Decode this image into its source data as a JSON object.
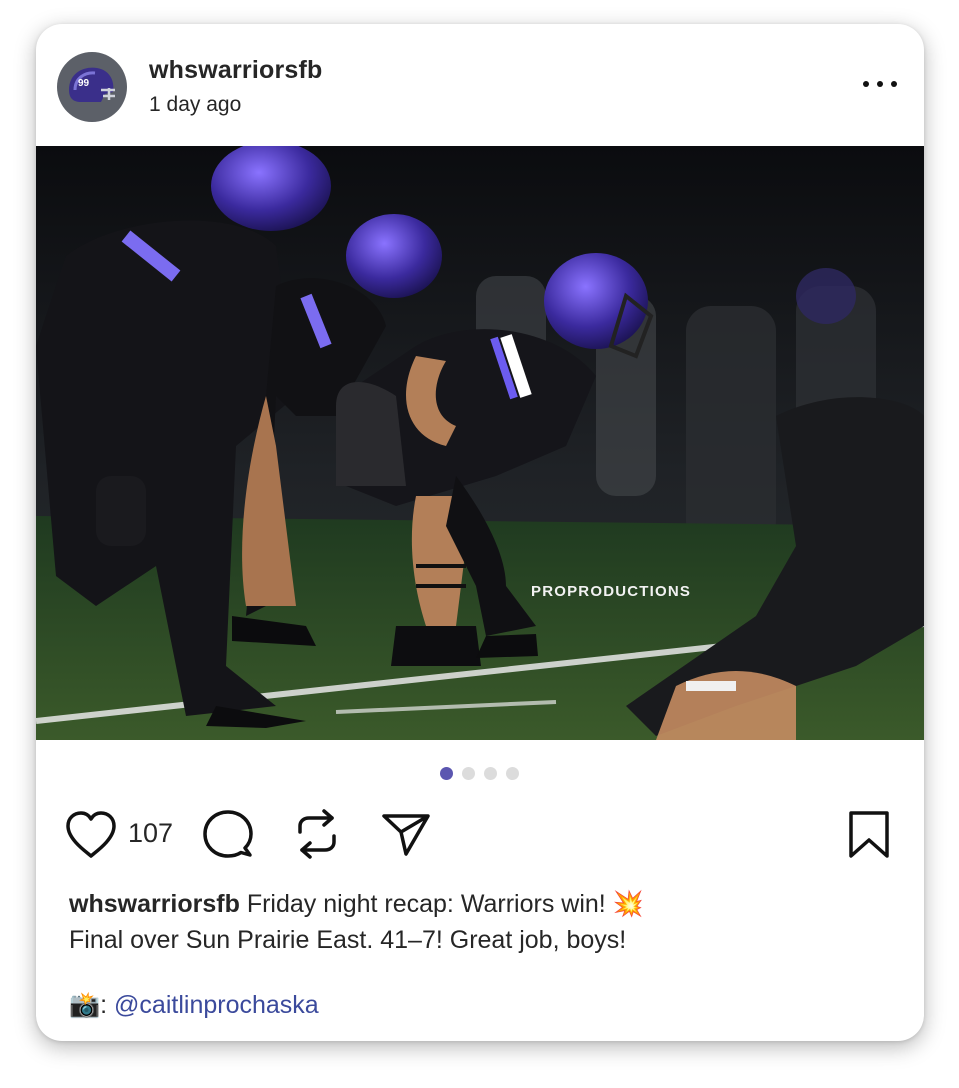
{
  "post": {
    "username": "whswarriorsfb",
    "timestamp": "1 day ago",
    "avatar_text": "99",
    "photo_watermark": "PROPRODUCTIONS",
    "carousel": {
      "count": 4,
      "active_index": 1
    },
    "likes": "107",
    "caption": {
      "username": "whswarriorsfb",
      "line1": "Friday night recap: Warriors win!",
      "emoji": "💥",
      "line2": "Final over Sun Prairie East. 41–7! Great job, boys!"
    },
    "credit": {
      "emoji": "📸",
      "separator": ":",
      "mention": "@caitlinprochaska"
    },
    "icons": {
      "more": "more-options-icon",
      "like": "heart-icon",
      "comment": "comment-icon",
      "repost": "repost-icon",
      "share": "send-icon",
      "save": "bookmark-icon"
    }
  },
  "colors": {
    "accent": "#5b56b0",
    "mention": "#3b4a9c",
    "text": "#262626"
  }
}
